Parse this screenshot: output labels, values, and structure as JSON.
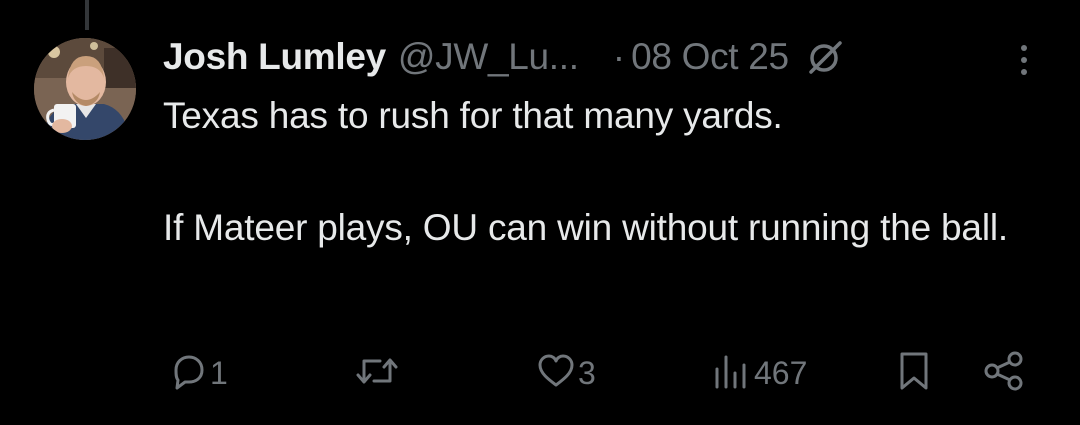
{
  "tweet": {
    "author_name": "Josh Lumley",
    "author_handle": "@JW_Lu...",
    "separator": "·",
    "date": "08 Oct 25",
    "body_paragraphs": [
      "Texas has to rush for that many yards.",
      "If Mateer plays, OU can win without running the ball."
    ]
  },
  "actions": {
    "reply_count": "1",
    "retweet_count": "",
    "like_count": "3",
    "views_count": "467"
  },
  "icons": {
    "grok": "grok-icon",
    "more": "more-dots-icon",
    "reply": "reply-icon",
    "retweet": "retweet-icon",
    "like": "heart-icon",
    "views": "views-icon",
    "bookmark": "bookmark-icon",
    "share": "share-icon"
  },
  "colors": {
    "background": "#000000",
    "text_primary": "#e7e9ea",
    "text_secondary": "#71767b",
    "thread_line": "#333639"
  }
}
